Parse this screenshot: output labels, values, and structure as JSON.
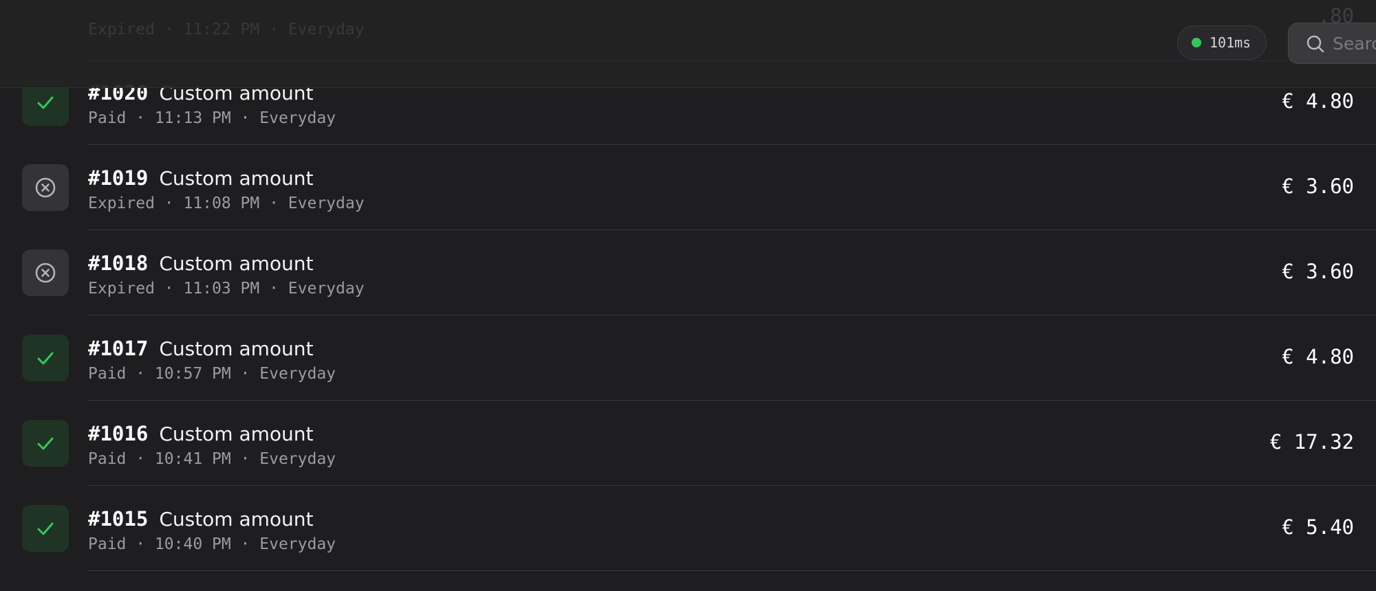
{
  "header": {
    "ghost_meta": "Expired · 11:22 PM · Everyday",
    "ghost_amount": ".80",
    "latency": "101ms",
    "latency_color": "#35c759",
    "search_placeholder": "Search"
  },
  "transactions": [
    {
      "order": "#1020",
      "description": "Custom amount",
      "meta": "Paid · 11:13 PM · Everyday",
      "amount": "€ 4.80",
      "status": "paid",
      "status_icon": "check-icon"
    },
    {
      "order": "#1019",
      "description": "Custom amount",
      "meta": "Expired · 11:08 PM · Everyday",
      "amount": "€ 3.60",
      "status": "expired",
      "status_icon": "circle-x-icon"
    },
    {
      "order": "#1018",
      "description": "Custom amount",
      "meta": "Expired · 11:03 PM · Everyday",
      "amount": "€ 3.60",
      "status": "expired",
      "status_icon": "circle-x-icon"
    },
    {
      "order": "#1017",
      "description": "Custom amount",
      "meta": "Paid · 10:57 PM · Everyday",
      "amount": "€ 4.80",
      "status": "paid",
      "status_icon": "check-icon"
    },
    {
      "order": "#1016",
      "description": "Custom amount",
      "meta": "Paid · 10:41 PM · Everyday",
      "amount": "€ 17.32",
      "status": "paid",
      "status_icon": "check-icon"
    },
    {
      "order": "#1015",
      "description": "Custom amount",
      "meta": "Paid · 10:40 PM · Everyday",
      "amount": "€ 5.40",
      "status": "paid",
      "status_icon": "check-icon"
    }
  ],
  "colors": {
    "paid_icon": "#34c759",
    "paid_bg": "#1f3425",
    "expired_icon": "#b5b5b9",
    "expired_bg": "#343437"
  }
}
